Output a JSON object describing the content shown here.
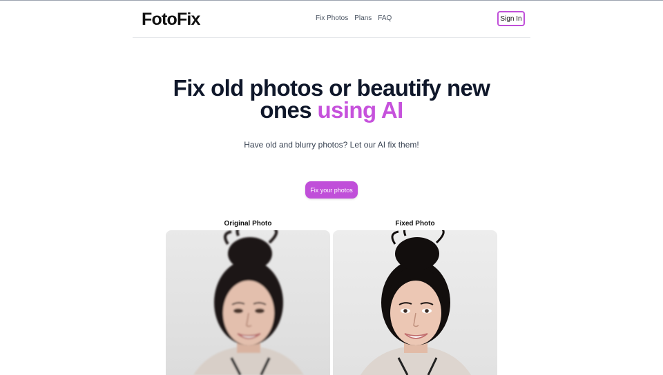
{
  "header": {
    "logo": "FotoFix",
    "nav": [
      "Fix Photos",
      "Plans",
      "FAQ"
    ],
    "signin_label": "Sign In"
  },
  "hero": {
    "title_part1": "Fix old photos or beautify new",
    "title_part2": "ones",
    "title_accent": "using AI",
    "subtitle": "Have old and blurry photos? Let our AI fix them!",
    "cta_label": "Fix your photos"
  },
  "comparison": {
    "original_label": "Original Photo",
    "fixed_label": "Fixed Photo"
  },
  "colors": {
    "accent": "#c652dc",
    "button": "#c04fd9",
    "text": "#0f172a"
  }
}
